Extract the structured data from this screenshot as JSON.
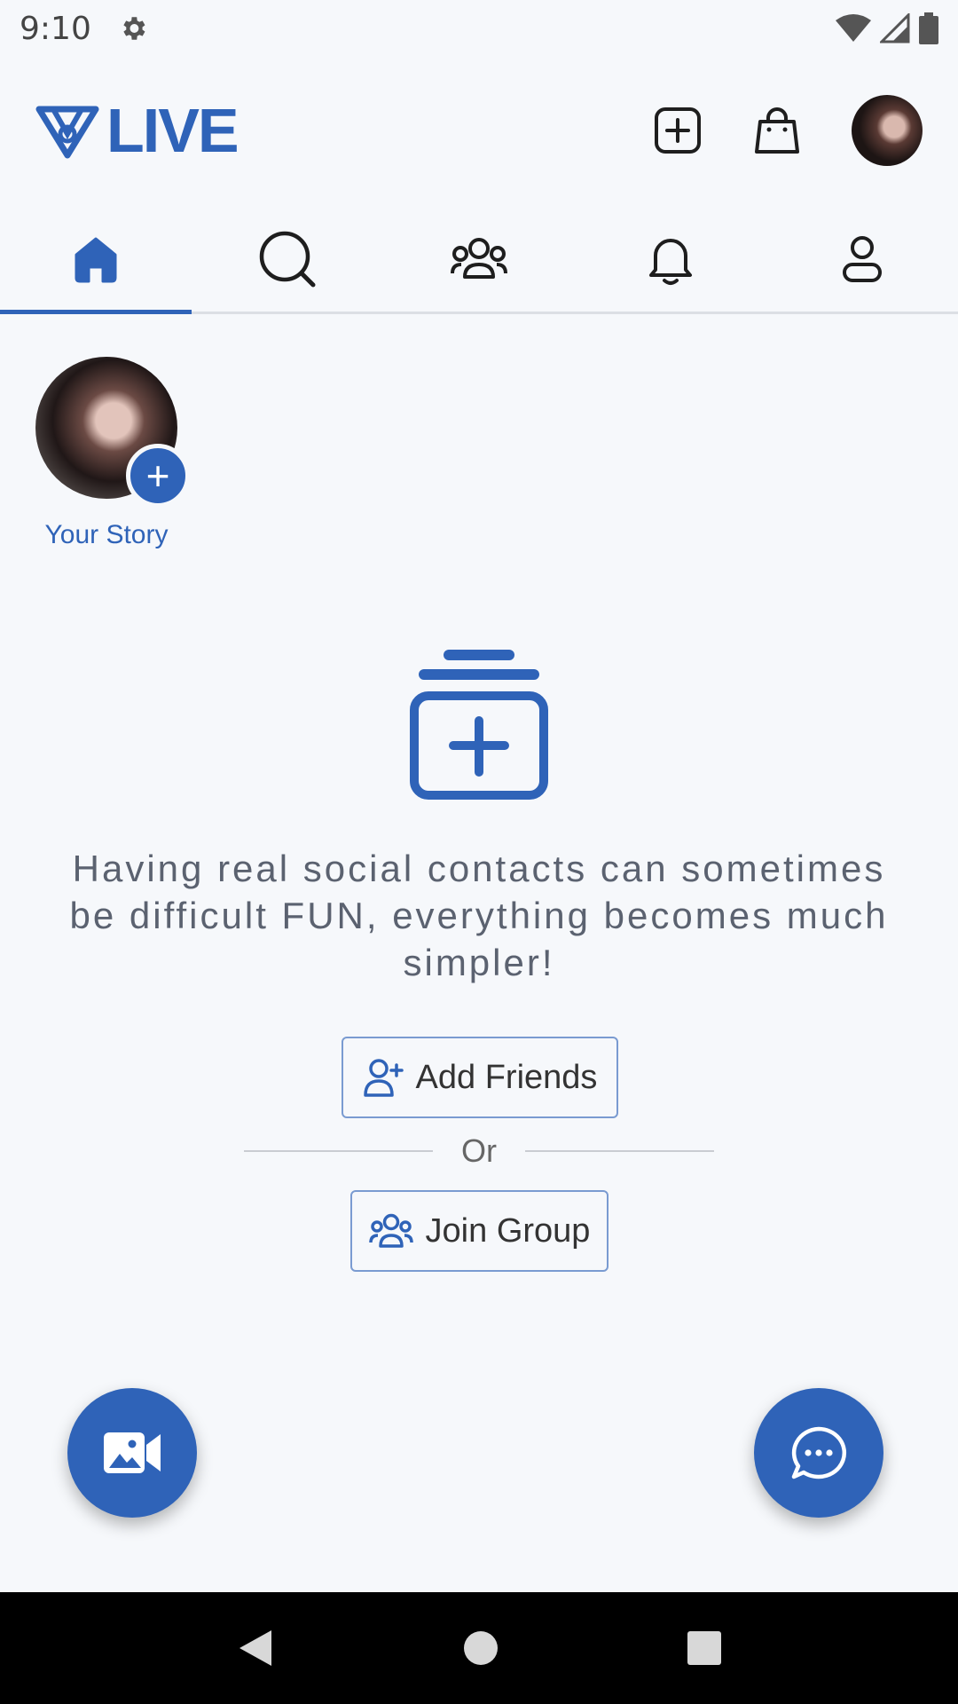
{
  "status_bar": {
    "time": "9:10",
    "icons": [
      "gear-icon",
      "wifi-icon",
      "signal-icon",
      "battery-icon"
    ]
  },
  "header": {
    "logo_text": "LIVE",
    "actions": [
      "add-post-icon",
      "shopping-bag-icon",
      "avatar"
    ]
  },
  "tabs": [
    {
      "icon": "home-icon",
      "active": true
    },
    {
      "icon": "search-icon",
      "active": false
    },
    {
      "icon": "groups-icon",
      "active": false
    },
    {
      "icon": "bell-icon",
      "active": false
    },
    {
      "icon": "profile-icon",
      "active": false
    }
  ],
  "story": {
    "label": "Your Story",
    "add_symbol": "+"
  },
  "empty_state": {
    "message": "Having real social contacts can sometimes be difficult FUN, everything becomes much simpler!",
    "add_friends_label": "Add Friends",
    "divider_label": "Or",
    "join_group_label": "Join Group"
  },
  "colors": {
    "accent": "#2f63b8",
    "background": "#f6f8fb",
    "message_text": "#5b6270"
  }
}
